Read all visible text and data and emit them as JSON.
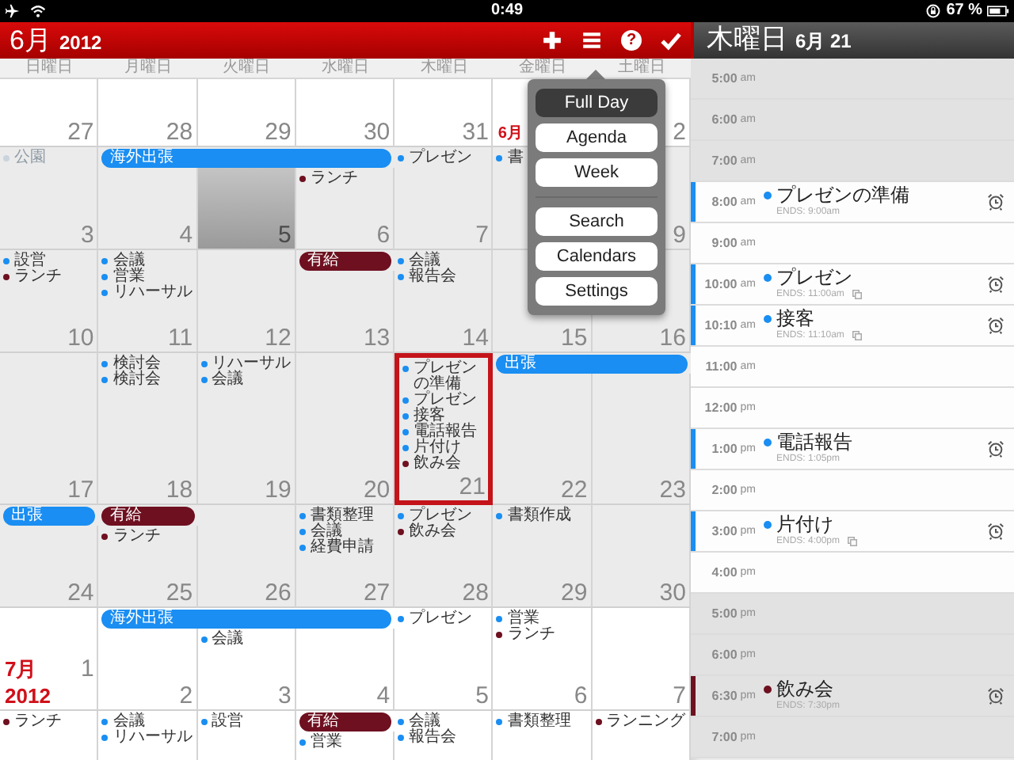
{
  "status_bar": {
    "time": "0:49",
    "battery": "67 %"
  },
  "calendar": {
    "title": {
      "month": "6月",
      "year": "2012"
    },
    "help": "?",
    "weekdays": [
      "日曜日",
      "月曜日",
      "火曜日",
      "水曜日",
      "木曜日",
      "金曜日",
      "土曜日"
    ],
    "weeks": [
      {
        "shaded": false,
        "cells": [
          {
            "number": "27",
            "selected": false,
            "highlighted": false
          },
          {
            "number": "28",
            "selected": false,
            "highlighted": false
          },
          {
            "number": "29",
            "selected": false,
            "highlighted": false
          },
          {
            "number": "30",
            "selected": false,
            "highlighted": false
          },
          {
            "number": "31",
            "selected": false,
            "highlighted": false
          },
          {
            "month_label": "6月",
            "selected": false,
            "highlighted": false
          },
          {
            "number": "2",
            "selected": false,
            "highlighted": false
          }
        ]
      },
      {
        "shaded": true,
        "cells": [
          {
            "number": "3",
            "selected": false,
            "highlighted": false,
            "events": [
              {
                "title": "公園",
                "color": "#c9d4de",
                "faded": true
              }
            ]
          },
          {
            "number": "4",
            "selected": false,
            "highlighted": false,
            "bar": {
              "title": "海外出張",
              "color": "#1a8ef2"
            }
          },
          {
            "number": "5",
            "selected": false,
            "highlighted": true,
            "bar_continues": true
          },
          {
            "number": "6",
            "selected": false,
            "highlighted": false,
            "bar_continues": true,
            "events": [
              {
                "title": "ランチ",
                "color": "#6e1020",
                "faded": false
              }
            ]
          },
          {
            "number": "7",
            "selected": false,
            "highlighted": false,
            "events": [
              {
                "title": "プレゼン",
                "color": "#1a8ef2",
                "faded": false
              }
            ]
          },
          {
            "selected": false,
            "highlighted": false,
            "events": [
              {
                "title": "書",
                "color": "#1a8ef2",
                "faded": false
              }
            ]
          },
          {
            "number": "9",
            "selected": false,
            "highlighted": false
          }
        ]
      },
      {
        "shaded": true,
        "cells": [
          {
            "number": "10",
            "selected": false,
            "highlighted": false,
            "events": [
              {
                "title": "設営",
                "color": "#1a8ef2",
                "faded": false
              },
              {
                "title": "ランチ",
                "color": "#6e1020",
                "faded": false
              }
            ]
          },
          {
            "number": "11",
            "selected": false,
            "highlighted": false,
            "events": [
              {
                "title": "会議",
                "color": "#1a8ef2",
                "faded": false
              },
              {
                "title": "営業",
                "color": "#1a8ef2",
                "faded": false
              },
              {
                "title": "リハーサル",
                "color": "#1a8ef2",
                "faded": false
              }
            ]
          },
          {
            "number": "12",
            "selected": false,
            "highlighted": false
          },
          {
            "number": "13",
            "selected": false,
            "highlighted": false,
            "bar": {
              "title": "有給",
              "color": "#6e1020"
            }
          },
          {
            "number": "14",
            "selected": false,
            "highlighted": false,
            "events": [
              {
                "title": "会議",
                "color": "#1a8ef2",
                "faded": false
              },
              {
                "title": "報告会",
                "color": "#1a8ef2",
                "faded": false
              }
            ]
          },
          {
            "number": "15",
            "selected": false,
            "highlighted": false
          },
          {
            "number": "16",
            "selected": false,
            "highlighted": false
          }
        ]
      },
      {
        "shaded": true,
        "cells": [
          {
            "number": "17",
            "selected": false,
            "highlighted": false
          },
          {
            "number": "18",
            "selected": false,
            "highlighted": false,
            "events": [
              {
                "title": "検討会",
                "color": "#1a8ef2",
                "faded": false
              },
              {
                "title": "検討会",
                "color": "#1a8ef2",
                "faded": false
              }
            ]
          },
          {
            "number": "19",
            "selected": false,
            "highlighted": false,
            "events": [
              {
                "title": "リハーサル",
                "color": "#1a8ef2",
                "faded": false
              },
              {
                "title": "会議",
                "color": "#1a8ef2",
                "faded": false
              }
            ]
          },
          {
            "number": "20",
            "selected": false,
            "highlighted": false
          },
          {
            "number": "21",
            "selected": true,
            "highlighted": false,
            "events": [
              {
                "title": "プレゼンの準備",
                "color": "#1a8ef2",
                "faded": false
              },
              {
                "title": "プレゼン",
                "color": "#1a8ef2",
                "faded": false
              },
              {
                "title": "接客",
                "color": "#1a8ef2",
                "faded": false
              },
              {
                "title": "電話報告",
                "color": "#1a8ef2",
                "faded": false
              },
              {
                "title": "片付け",
                "color": "#1a8ef2",
                "faded": false
              },
              {
                "title": "飲み会",
                "color": "#6e1020",
                "faded": false
              }
            ]
          },
          {
            "number": "22",
            "selected": false,
            "highlighted": false,
            "bar": {
              "title": "出張",
              "color": "#1a8ef2"
            }
          },
          {
            "number": "23",
            "selected": false,
            "highlighted": false,
            "bar_continues": true
          }
        ]
      },
      {
        "shaded": true,
        "cells": [
          {
            "number": "24",
            "selected": false,
            "highlighted": false,
            "bar": {
              "title": "出張",
              "color": "#1a8ef2"
            }
          },
          {
            "number": "25",
            "selected": false,
            "highlighted": false,
            "bar": {
              "title": "有給",
              "color": "#6e1020"
            },
            "events": [
              {
                "title": "ランチ",
                "color": "#6e1020",
                "faded": false
              }
            ]
          },
          {
            "number": "26",
            "selected": false,
            "highlighted": false
          },
          {
            "number": "27",
            "selected": false,
            "highlighted": false,
            "events": [
              {
                "title": "書類整理",
                "color": "#1a8ef2",
                "faded": false
              },
              {
                "title": "会議",
                "color": "#1a8ef2",
                "faded": false
              },
              {
                "title": "経費申請",
                "color": "#1a8ef2",
                "faded": false
              }
            ]
          },
          {
            "number": "28",
            "selected": false,
            "highlighted": false,
            "events": [
              {
                "title": "プレゼン",
                "color": "#1a8ef2",
                "faded": false
              },
              {
                "title": "飲み会",
                "color": "#6e1020",
                "faded": false
              }
            ]
          },
          {
            "number": "29",
            "selected": false,
            "highlighted": false,
            "events": [
              {
                "title": "書類作成",
                "color": "#1a8ef2",
                "faded": false
              }
            ]
          },
          {
            "number": "30",
            "selected": false,
            "highlighted": false
          }
        ]
      },
      {
        "shaded": false,
        "cells": [
          {
            "month_label": "7月 2012",
            "number": "1",
            "selected": false,
            "highlighted": false
          },
          {
            "number": "2",
            "selected": false,
            "highlighted": false,
            "bar": {
              "title": "海外出張",
              "color": "#1a8ef2"
            }
          },
          {
            "number": "3",
            "selected": false,
            "highlighted": false,
            "bar_continues": true,
            "events": [
              {
                "title": "会議",
                "color": "#1a8ef2",
                "faded": false
              }
            ]
          },
          {
            "number": "4",
            "selected": false,
            "highlighted": false,
            "bar_continues": true
          },
          {
            "number": "5",
            "selected": false,
            "highlighted": false,
            "events": [
              {
                "title": "プレゼン",
                "color": "#1a8ef2",
                "faded": false
              }
            ]
          },
          {
            "number": "6",
            "selected": false,
            "highlighted": false,
            "events": [
              {
                "title": "営業",
                "color": "#1a8ef2",
                "faded": false
              },
              {
                "title": "ランチ",
                "color": "#6e1020",
                "faded": false
              }
            ]
          },
          {
            "number": "7",
            "selected": false,
            "highlighted": false
          }
        ]
      },
      {
        "shaded": false,
        "cells": [
          {
            "selected": false,
            "highlighted": false,
            "events": [
              {
                "title": "ランチ",
                "color": "#6e1020",
                "faded": false
              }
            ]
          },
          {
            "selected": false,
            "highlighted": false,
            "events": [
              {
                "title": "会議",
                "color": "#1a8ef2",
                "faded": false
              },
              {
                "title": "リハーサル",
                "color": "#1a8ef2",
                "faded": false
              }
            ]
          },
          {
            "selected": false,
            "highlighted": false,
            "events": [
              {
                "title": "設営",
                "color": "#1a8ef2",
                "faded": false
              }
            ]
          },
          {
            "selected": false,
            "highlighted": false,
            "bar": {
              "title": "有給",
              "color": "#6e1020"
            },
            "events": [
              {
                "title": "営業",
                "color": "#1a8ef2",
                "faded": false
              }
            ]
          },
          {
            "selected": false,
            "highlighted": false,
            "events": [
              {
                "title": "会議",
                "color": "#1a8ef2",
                "faded": false
              },
              {
                "title": "報告会",
                "color": "#1a8ef2",
                "faded": false
              }
            ]
          },
          {
            "selected": false,
            "highlighted": false,
            "events": [
              {
                "title": "書類整理",
                "color": "#1a8ef2",
                "faded": false
              }
            ]
          },
          {
            "selected": false,
            "highlighted": false,
            "events": [
              {
                "title": "ランニング",
                "color": "#6e1020",
                "faded": false
              }
            ]
          }
        ]
      }
    ],
    "menu": {
      "groups": [
        {
          "items": [
            {
              "label": "Full Day",
              "selected": true
            },
            {
              "label": "Agenda",
              "selected": false
            },
            {
              "label": "Week",
              "selected": false
            }
          ]
        },
        {
          "items": [
            {
              "label": "Search",
              "selected": false
            },
            {
              "label": "Calendars",
              "selected": false
            },
            {
              "label": "Settings",
              "selected": false
            }
          ]
        }
      ]
    }
  },
  "day_panel": {
    "title": {
      "weekday": "木曜日",
      "date": "6月 21"
    },
    "slots": [
      {
        "time": "5:00",
        "period": "am",
        "shaded": true
      },
      {
        "time": "6:00",
        "period": "am",
        "shaded": true
      },
      {
        "time": "7:00",
        "period": "am",
        "shaded": true
      },
      {
        "time": "8:00",
        "period": "am",
        "shaded": false,
        "event": {
          "title": "プレゼンの準備",
          "ends": "ENDS: 9:00am",
          "color": "#1a8ef2",
          "linked": false,
          "alarm": true
        }
      },
      {
        "time": "9:00",
        "period": "am",
        "shaded": false
      },
      {
        "time": "10:00",
        "period": "am",
        "shaded": false,
        "event": {
          "title": "プレゼン",
          "ends": "ENDS: 11:00am",
          "color": "#1a8ef2",
          "linked": true,
          "alarm": true
        }
      },
      {
        "time": "10:10",
        "period": "am",
        "shaded": false,
        "event": {
          "title": "接客",
          "ends": "ENDS: 11:10am",
          "color": "#1a8ef2",
          "linked": true,
          "alarm": true
        }
      },
      {
        "time": "11:00",
        "period": "am",
        "shaded": false
      },
      {
        "time": "12:00",
        "period": "pm",
        "shaded": false
      },
      {
        "time": "1:00",
        "period": "pm",
        "shaded": false,
        "event": {
          "title": "電話報告",
          "ends": "ENDS: 1:05pm",
          "color": "#1a8ef2",
          "linked": false,
          "alarm": true
        }
      },
      {
        "time": "2:00",
        "period": "pm",
        "shaded": false
      },
      {
        "time": "3:00",
        "period": "pm",
        "shaded": false,
        "event": {
          "title": "片付け",
          "ends": "ENDS: 4:00pm",
          "color": "#1a8ef2",
          "linked": true,
          "alarm": true
        }
      },
      {
        "time": "4:00",
        "period": "pm",
        "shaded": false
      },
      {
        "time": "5:00",
        "period": "pm",
        "shaded": true
      },
      {
        "time": "6:00",
        "period": "pm",
        "shaded": true
      },
      {
        "time": "6:30",
        "period": "pm",
        "shaded": true,
        "event": {
          "title": "飲み会",
          "ends": "ENDS: 7:30pm",
          "color": "#6e1020",
          "linked": false,
          "alarm": true
        }
      },
      {
        "time": "7:00",
        "period": "pm",
        "shaded": true
      }
    ]
  }
}
